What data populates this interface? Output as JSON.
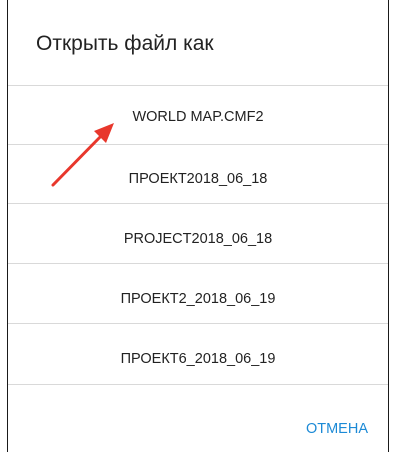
{
  "dialog": {
    "title": "Открыть файл как",
    "files": [
      "WORLD MAP.CMF2",
      "ПРОЕКТ2018_06_18",
      "PROJECT2018_06_18",
      "ПРОЕКТ2_2018_06_19",
      "ПРОЕКТ6_2018_06_19"
    ],
    "cancel_label": "ОТМЕНА",
    "accent_color": "#1c8ad6",
    "annotation_color": "#e8372c"
  }
}
